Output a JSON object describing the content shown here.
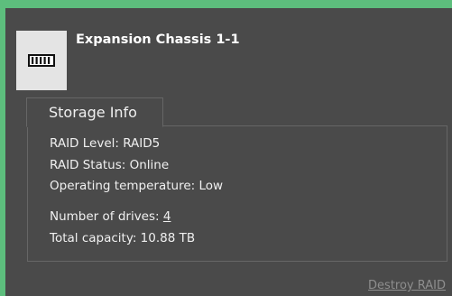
{
  "device": {
    "title": "Expansion Chassis 1-1",
    "icon": "chassis-icon"
  },
  "storage_info": {
    "tab_label": "Storage Info",
    "raid_level": "RAID Level: RAID5",
    "raid_status": "RAID Status: Online",
    "operating_temperature": "Operating temperature: Low",
    "number_of_drives_label": "Number of drives: ",
    "number_of_drives_value": "4",
    "total_capacity": "Total capacity: 10.88 TB"
  },
  "actions": {
    "destroy_raid": "Destroy RAID"
  },
  "colors": {
    "accent": "#5dbe7d",
    "panel_background": "#4a4a4a",
    "text": "#f0f0f0",
    "muted_link": "#8e8e8e"
  }
}
